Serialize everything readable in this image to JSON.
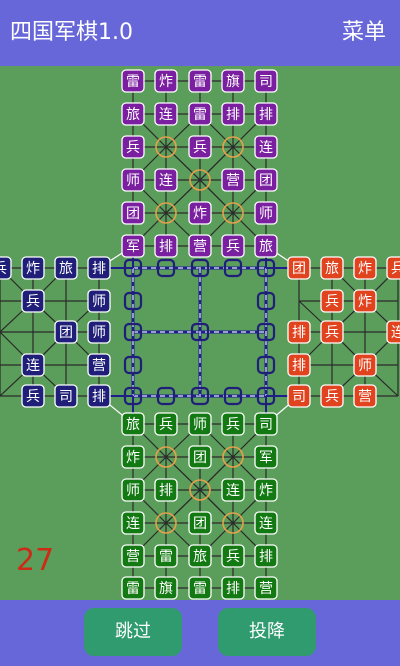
{
  "app": {
    "title": "四国军棋1.0",
    "menu_label": "菜单"
  },
  "board": {
    "move_counter": "27",
    "colors": {
      "board_bg": "#5b9e5b",
      "line": "#2a2a2a",
      "purple": "#7a1fa0",
      "red": "#e0431e",
      "navy": "#1f1f7a",
      "green": "#137a13",
      "camp": "#e8a04a",
      "node": "#1f1f7a"
    },
    "top_pieces": [
      [
        "雷",
        "炸",
        "雷",
        "旗",
        "司"
      ],
      [
        "旅",
        "连",
        "雷",
        "排",
        "排"
      ],
      [
        "兵",
        "",
        "兵",
        "",
        "连"
      ],
      [
        "师",
        "连",
        "",
        "营",
        "团"
      ],
      [
        "团",
        "",
        "炸",
        "",
        "师"
      ],
      [
        "军",
        "排",
        "营",
        "兵",
        "旅"
      ]
    ],
    "bottom_pieces": [
      [
        "旅",
        "兵",
        "师",
        "兵",
        "司"
      ],
      [
        "炸",
        "",
        "团",
        "",
        "军"
      ],
      [
        "师",
        "排",
        "",
        "连",
        "炸"
      ],
      [
        "连",
        "",
        "团",
        "",
        "连"
      ],
      [
        "营",
        "雷",
        "旅",
        "兵",
        "排"
      ],
      [
        "雷",
        "旗",
        "雷",
        "排",
        "营"
      ]
    ],
    "left_pieces": [
      [
        "兵",
        "",
        "",
        "",
        ""
      ],
      [
        "炸",
        "兵",
        "",
        "连",
        "兵"
      ],
      [
        "旅",
        "",
        "团",
        "",
        "司"
      ],
      [
        "排",
        "师",
        "师",
        "营",
        "排"
      ]
    ],
    "right_pieces": [
      [
        "团",
        "",
        "排",
        "排",
        "司"
      ],
      [
        "旅",
        "兵",
        "兵",
        "",
        "兵"
      ],
      [
        "炸",
        "炸",
        "",
        "师",
        "营"
      ],
      [
        "兵",
        "",
        "连",
        "",
        ""
      ]
    ]
  },
  "actions": {
    "skip": "跳过",
    "surrender": "投降"
  }
}
